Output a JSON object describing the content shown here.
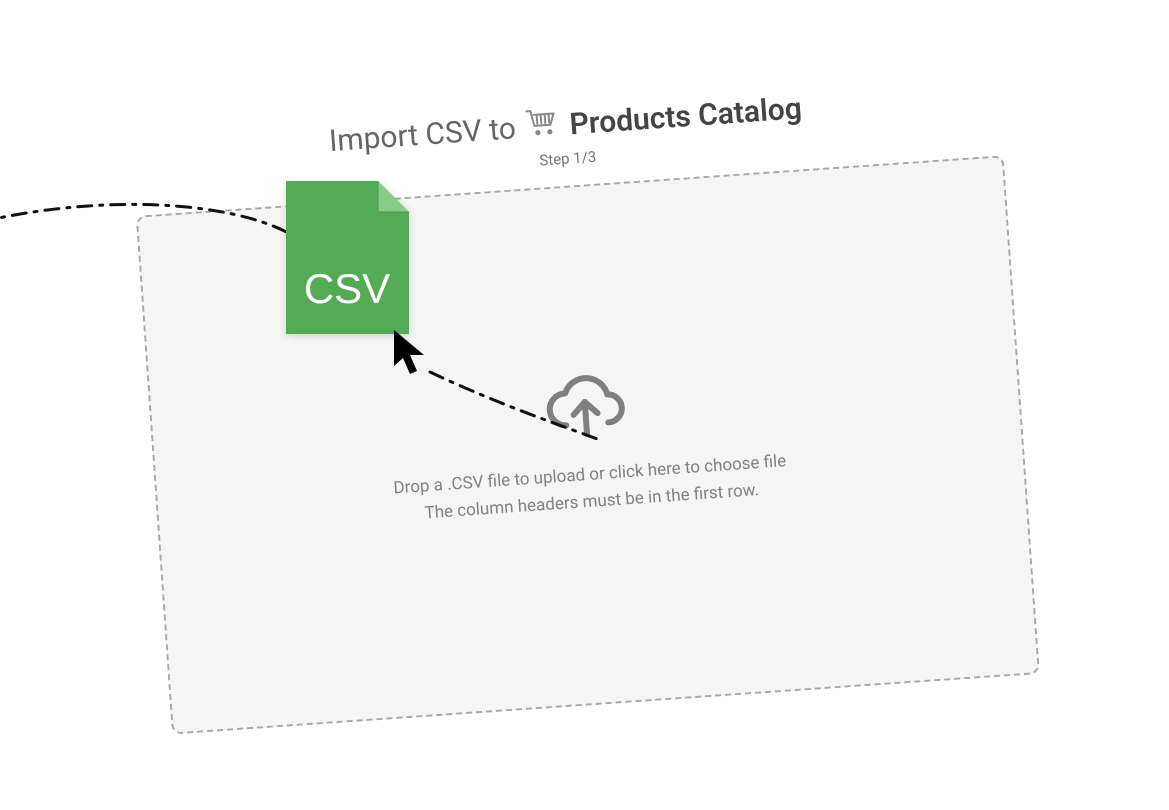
{
  "header": {
    "title_prefix": "Import CSV to",
    "catalog_name": "Products Catalog",
    "step_label": "Step 1/3"
  },
  "dropzone": {
    "line1": "Drop a .CSV file to upload or click here to choose file",
    "line2": "The column headers must be in the first row."
  },
  "dragged_file": {
    "label": "CSV"
  },
  "colors": {
    "csv_green": "#55ab55",
    "csv_fold": "#7bc47b",
    "border_gray": "#a9a9a9",
    "panel_bg": "#f5f5f5",
    "icon_gray": "#808080"
  }
}
